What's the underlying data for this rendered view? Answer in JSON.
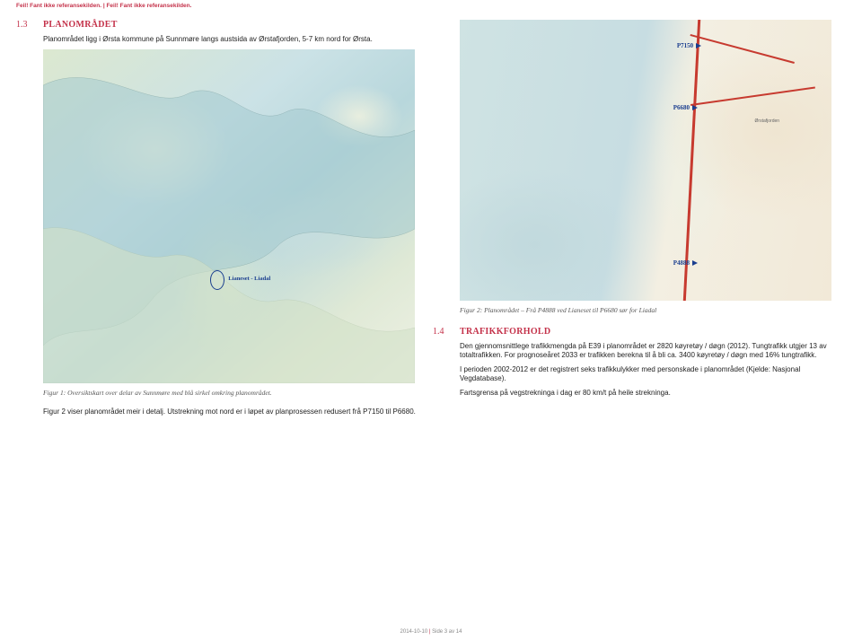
{
  "header_error": "Feil! Fant ikke referansekilden. | Feil! Fant ikke referansekilden.",
  "left": {
    "sec_num": "1.3",
    "sec_title": "PLANOMRÅDET",
    "para1": "Planområdet ligg i Ørsta kommune på Sunnmøre langs austsida av Ørstafjorden, 5-7 km nord for Ørsta.",
    "map1_circle_label": "Lianeset - Liadal",
    "caption1": "Figur 1: Oversiktskart over delar av Sunnmøre med blå sirkel omkring planområdet.",
    "para2": "Figur 2 viser planområdet meir i detalj. Utstrekning mot nord er i løpet av planprosessen redusert frå P7150 til P6680."
  },
  "right": {
    "markers": {
      "p7150": "P7150",
      "p6680": "P6680",
      "p4888": "P4888"
    },
    "fjord": "Ørstafjorden",
    "caption2": "Figur 2: Planområdet – Frå P4888 ved Lianeset til P6680 sør for Liadal",
    "sec_num": "1.4",
    "sec_title": "TRAFIKKFORHOLD",
    "para1": "Den gjennomsnittlege trafikkmengda på E39 i planområdet er 2820 køyretøy / døgn (2012). Tungtrafikk utgjer 13  av totaltrafikken. For prognoseåret 2033 er trafikken berekna til å bli ca. 3400 køyretøy / døgn med 16% tungtrafikk.",
    "para2": "I perioden 2002-2012 er det registrert seks trafikkulykker med personskade i planområdet (Kjelde: Nasjonal Vegdatabase).",
    "para3": "Fartsgrensa på vegstrekninga i dag er 80 km/t på heile strekninga."
  },
  "footer": {
    "date": "2014-10-10",
    "sep": " | ",
    "page": "Side 3 av 14"
  }
}
